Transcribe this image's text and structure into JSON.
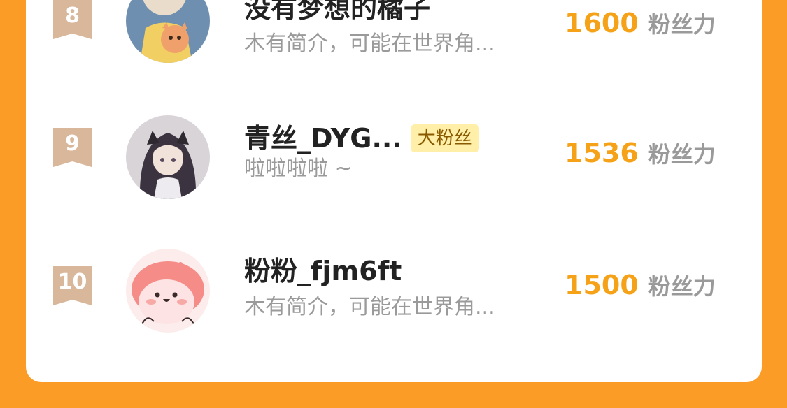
{
  "ranking": {
    "unit_label": "粉丝力",
    "rows": [
      {
        "rank": "8",
        "name": "没有梦想的橘子",
        "badge": "",
        "bio": "木有简介，可能在世界角...",
        "score": "1600",
        "avatar_icon": "avatar-girl-with-cat-icon"
      },
      {
        "rank": "9",
        "name": "青丝_DYG...",
        "badge": "大粉丝",
        "bio": "啦啦啦啦 ~",
        "score": "1536",
        "avatar_icon": "avatar-anime-girl-icon"
      },
      {
        "rank": "10",
        "name": "粉粉_fjm6ft",
        "badge": "",
        "bio": "木有简介，可能在世界角...",
        "score": "1500",
        "avatar_icon": "avatar-pink-blob-icon"
      }
    ]
  },
  "colors": {
    "page_background": "#FB9C27",
    "card_background": "#ffffff",
    "rank_badge": "#D9B79B",
    "score": "#F5A218",
    "muted_text": "#9a9a9a",
    "badge_background": "#FFEFA8"
  }
}
